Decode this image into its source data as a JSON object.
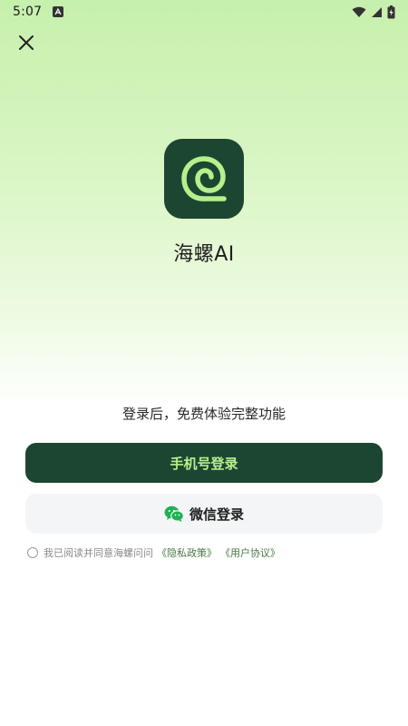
{
  "status_bar": {
    "time": "5:07",
    "icons": [
      "notification-a-icon",
      "wifi-icon",
      "cell-signal-icon",
      "battery-icon"
    ]
  },
  "header": {
    "close_icon": "close-icon"
  },
  "app": {
    "name": "海螺AI",
    "logo_icon": "snail-shell-logo-icon"
  },
  "login": {
    "tagline": "登录后，免费体验完整功能",
    "phone_button": "手机号登录",
    "wechat_button": "微信登录",
    "wechat_icon": "wechat-icon"
  },
  "agreement": {
    "text": "我已阅读并同意海螺问问",
    "privacy_link": "《隐私政策》",
    "terms_link": "《用户协议》",
    "checked": false
  },
  "colors": {
    "primary": "#1d4632",
    "primary_text": "#b6f08c",
    "gradient_top": "#c6f0ad",
    "secondary_button": "#f4f5f6"
  }
}
